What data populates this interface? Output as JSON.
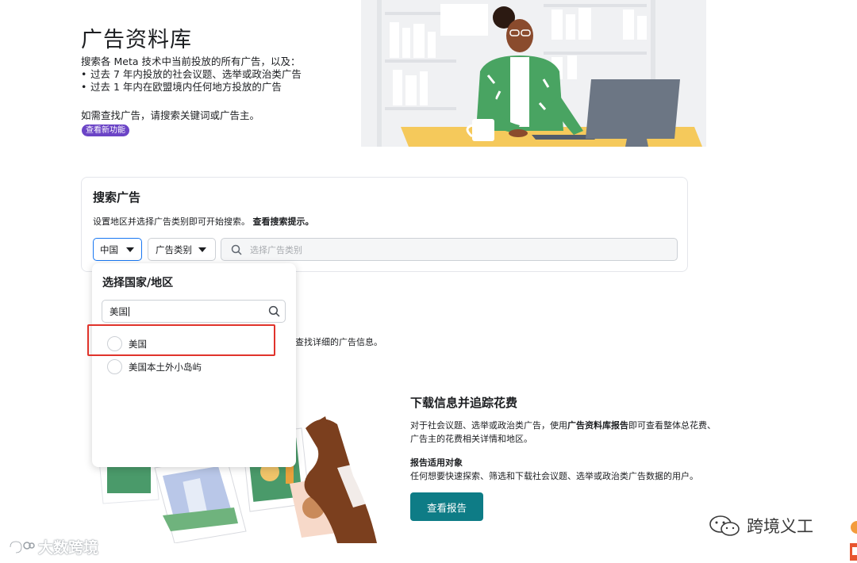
{
  "hero": {
    "title": "广告资料库",
    "description": "搜索各 Meta 技术中当前投放的所有广告，以及：",
    "bullets": [
      "过去 7 年内投放的社会议题、选举或政治类广告",
      "过去 1 年内在欧盟境内任何地方投放的广告"
    ],
    "hint": "如需查找广告，请搜索关键词或广告主。",
    "badge": "查看新功能"
  },
  "search": {
    "title": "搜索广告",
    "subtitle": "设置地区并选择广告类别即可开始搜索。",
    "tips_link": "查看搜索提示。",
    "country_value": "中国",
    "category_value": "广告类别",
    "placeholder": "选择广告类别"
  },
  "country_dropdown": {
    "title": "选择国家/地区",
    "query": "美国",
    "options": [
      "美国",
      "美国本土外小岛屿"
    ]
  },
  "partial_text": "查找详细的广告信息。",
  "download": {
    "title": "下载信息并追踪花费",
    "desc_prefix": "对于社会议题、选举或政治类广告，使用",
    "desc_bold": "广告资料库报告",
    "desc_suffix": "即可查看整体总花费、广告主的花费相关详情和地区。",
    "audience_title": "报告适用对象",
    "audience_desc": "任何想要快速探索、筛选和下载社会议题、选举或政治类广告数据的用户。",
    "button": "查看报告"
  },
  "watermarks": {
    "left": "大数跨境",
    "right": "跨境义工"
  },
  "colors": {
    "accent_blue": "#1877f2",
    "badge_purple": "#6b44c6",
    "button_teal": "#0e7c86",
    "highlight_red": "#e0332b"
  },
  "icons": [
    "caret-down-icon",
    "search-icon",
    "wechat-icon"
  ]
}
